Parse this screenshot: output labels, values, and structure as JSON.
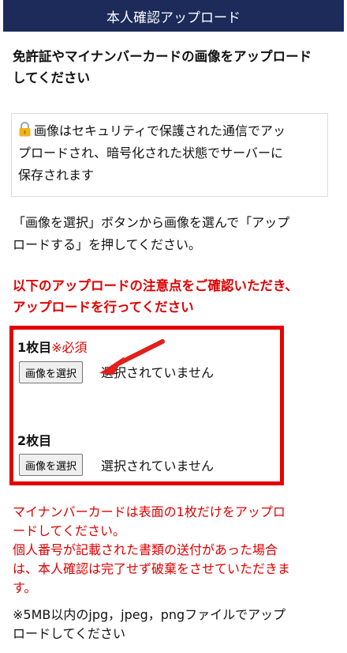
{
  "header": {
    "title": "本人確認アップロード"
  },
  "subtitle": {
    "line1": "免許証やマイナンバーカードの画像をアップロード",
    "line2": "してください"
  },
  "security": {
    "icon": "lock-icon",
    "line1": "画像はセキュリティで保護された通信でアッ",
    "line2": "プロードされ、暗号化された状態でサーバーに",
    "line3": "保存されます"
  },
  "instruction": {
    "line1": "「画像を選択」ボタンから画像を選んで「アップ",
    "line2": "ロードする」を押してください。"
  },
  "notice": {
    "line1": "以下のアップロードの注意点をご確認いただき、",
    "line2": "アップロードを行ってください",
    "color": "#e00000"
  },
  "uploads": {
    "slot1": {
      "label": "1枚目",
      "required": "※必須",
      "button": "画像を選択",
      "status": "選択されていません"
    },
    "slot2": {
      "label": "2枚目",
      "button": "画像を選択",
      "status": "選択されていません"
    }
  },
  "notes": {
    "line1": "マイナンバーカードは表面の1枚だけをアップロ",
    "line2": "ードしてください。",
    "line3": "個人番号が記載された書類の送付があった場合",
    "line4": "は、本人確認は完了せず破棄をさせていただきま",
    "line5": "す。",
    "format_line1": "※5MB以内のjpg，jpeg，pngファイルでアップ",
    "format_line2": "ロードしてください"
  },
  "colors": {
    "header_bg": "#1c2b5a",
    "accent_red": "#e30000"
  }
}
